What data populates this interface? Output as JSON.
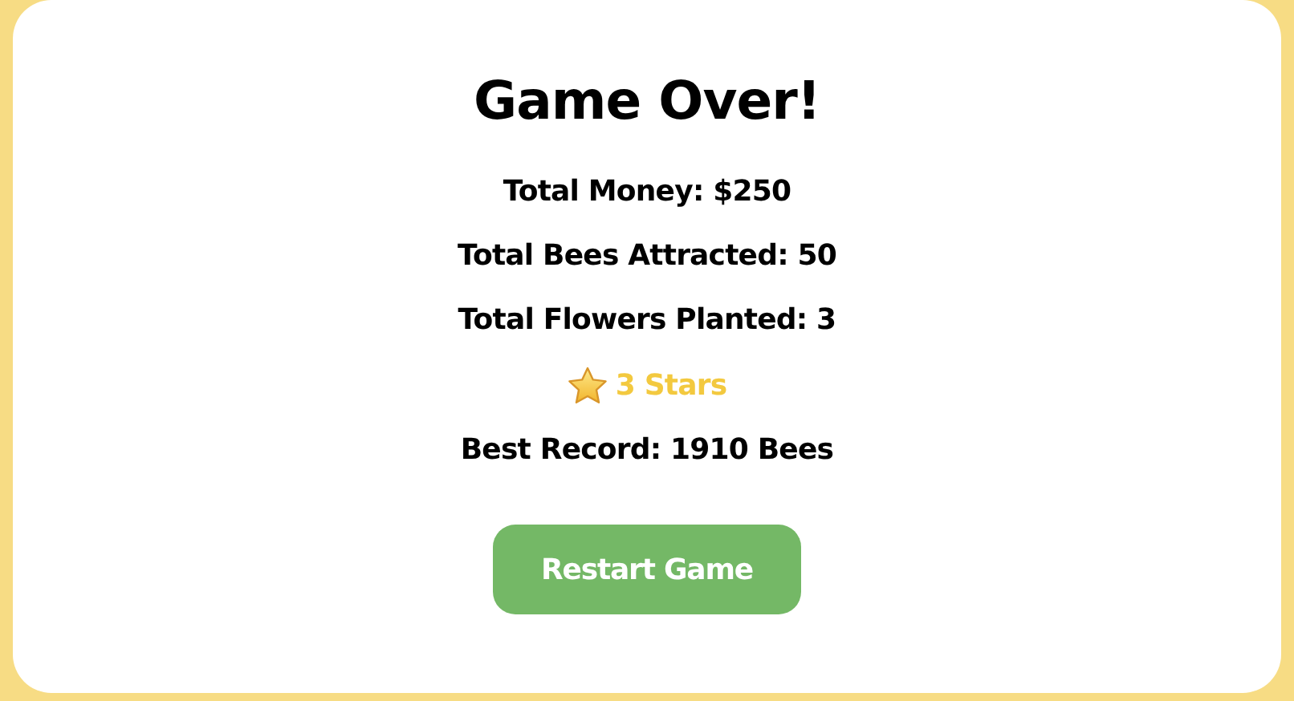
{
  "title": "Game Over!",
  "stats": [
    {
      "kind": "plain",
      "text": "Total Money: $250"
    },
    {
      "kind": "plain",
      "text": "Total Bees Attracted: 50"
    },
    {
      "kind": "plain",
      "text": "Total Flowers Planted: 3"
    },
    {
      "kind": "rating",
      "text": "3 Stars"
    },
    {
      "kind": "plain",
      "text": "Best Record: 1910 Bees"
    }
  ],
  "button": "Restart Game"
}
